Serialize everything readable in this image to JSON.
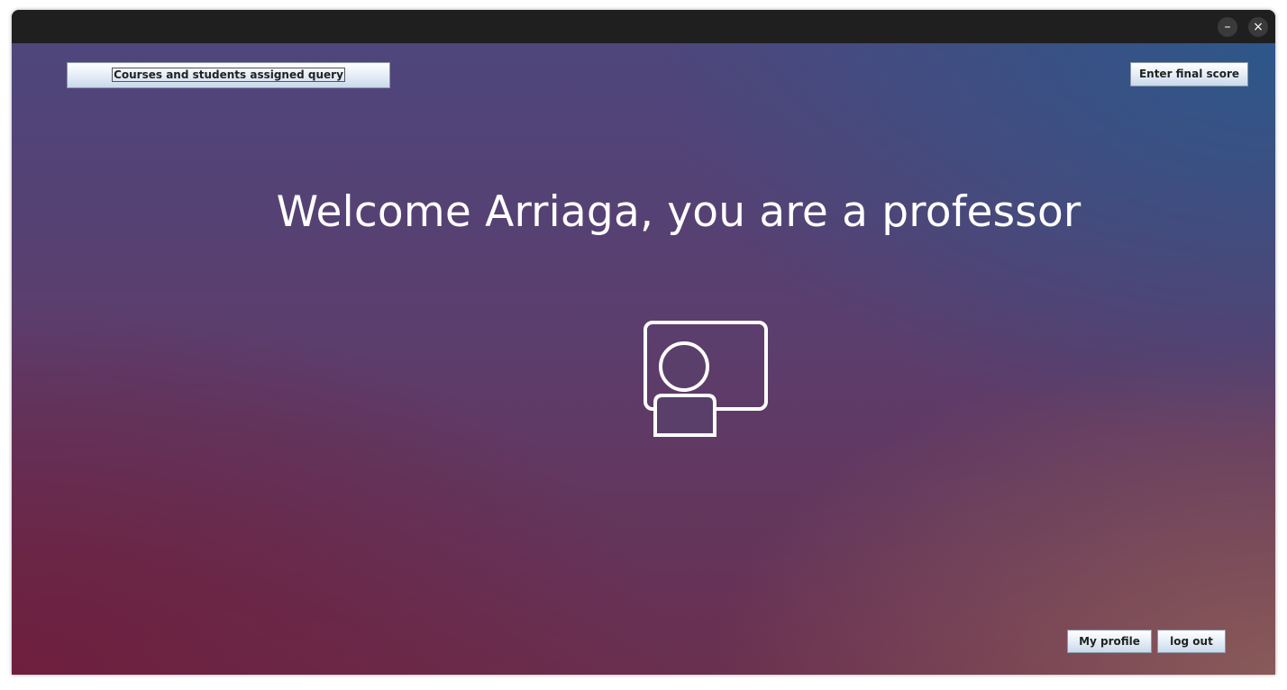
{
  "window": {
    "minimize_label": "–",
    "close_label": "×"
  },
  "toolbar": {
    "courses_query_label": "Courses and students assigned query",
    "final_score_label": "Enter final score"
  },
  "main": {
    "welcome_text": "Welcome Arriaga, you are a professor",
    "icon": "teacher-board-icon"
  },
  "footer": {
    "profile_label": "My profile",
    "logout_label": "log out"
  }
}
